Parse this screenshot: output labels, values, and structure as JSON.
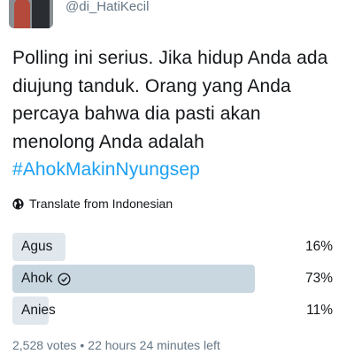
{
  "tweet": {
    "handle": "@di_HatiKecil",
    "text": "Polling ini serius. Jika hidup Anda ada diujung tanduk. Orang yang Anda percaya bahwa dia pasti akan menolong Anda adalah",
    "hashtag": "#AhokMakinNyungsep",
    "translate_label": "Translate from Indonesian"
  },
  "poll": {
    "options": [
      {
        "label": "Agus",
        "percent_text": "16%",
        "percent": 16,
        "selected": false
      },
      {
        "label": "Ahok",
        "percent_text": "73%",
        "percent": 73,
        "selected": true
      },
      {
        "label": "Anies",
        "percent_text": "11%",
        "percent": 11,
        "selected": false
      }
    ],
    "votes": "2,528 votes",
    "separator": "•",
    "time_left": "22 hours 24 minutes left"
  },
  "icons": [
    "avatar",
    "globe-icon",
    "check-circle-icon"
  ],
  "colors": {
    "hashtag": "#1da1f2",
    "bar": "#e1e8ed",
    "bar_winner": "#c9d7e1",
    "muted": "#657786"
  }
}
